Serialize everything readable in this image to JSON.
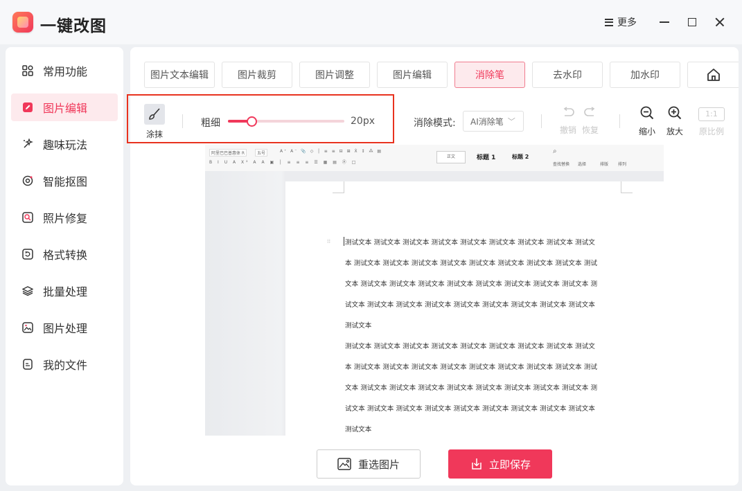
{
  "app": {
    "title": "一键改图",
    "more_label": "更多"
  },
  "colors": {
    "accent": "#f0385a",
    "accent_bg": "#fdeaed",
    "highlight_border": "#e8321e"
  },
  "sidebar": {
    "items": [
      {
        "label": "常用功能",
        "icon": "grid-icon"
      },
      {
        "label": "图片编辑",
        "icon": "edit-icon",
        "active": true
      },
      {
        "label": "趣味玩法",
        "icon": "sparkle-icon"
      },
      {
        "label": "智能抠图",
        "icon": "target-icon"
      },
      {
        "label": "照片修复",
        "icon": "repair-icon"
      },
      {
        "label": "格式转换",
        "icon": "convert-icon"
      },
      {
        "label": "批量处理",
        "icon": "layers-icon"
      },
      {
        "label": "图片处理",
        "icon": "image-icon"
      },
      {
        "label": "我的文件",
        "icon": "file-icon"
      }
    ]
  },
  "tabs": [
    {
      "label": "图片文本编辑"
    },
    {
      "label": "图片裁剪"
    },
    {
      "label": "图片调整"
    },
    {
      "label": "图片编辑"
    },
    {
      "label": "消除笔",
      "active": true
    },
    {
      "label": "去水印"
    },
    {
      "label": "加水印"
    }
  ],
  "toolbar": {
    "smear_label": "涂抹",
    "size_label": "粗细",
    "size_value": "20px",
    "size_fraction": 0.2,
    "mode_label": "消除模式:",
    "mode_value": "AI消除笔",
    "undo_label": "撤销",
    "redo_label": "恢复",
    "zoom_out_label": "缩小",
    "zoom_in_label": "放大",
    "ratio_button": "1:1",
    "original_label": "原比例"
  },
  "document": {
    "ribbon": {
      "font_name": "阿里巴巴普惠体 R",
      "font_size": "五号",
      "style_normal": "正文",
      "style_h1": "标题 1",
      "style_h2": "标题 2",
      "find_replace": "查找替换",
      "select": "选择",
      "sort": "排版",
      "arrange": "排列"
    },
    "paragraph1": [
      "测试文本 测试文本 测试文本 测试文本 测试文本 测试文本 测试文本 测试文本 测试文",
      "本 测试文本 测试文本 测试文本 测试文本 测试文本 测试文本 测试文本 测试文本 测试",
      "文本 测试文本 测试文本 测试文本 测试文本 测试文本 测试文本 测试文本 测试文本 测",
      "试文本 测试文本 测试文本 测试文本 测试文本 测试文本 测试文本 测试文本 测试文本",
      "测试文本"
    ],
    "paragraph2": [
      "测试文本 测试文本 测试文本 测试文本 测试文本 测试文本 测试文本 测试文本 测试文",
      "本 测试文本 测试文本 测试文本 测试文本 测试文本 测试文本 测试文本 测试文本 测试",
      "文本 测试文本 测试文本 测试文本 测试文本 测试文本 测试文本 测试文本 测试文本 测",
      "试文本 测试文本 测试文本 测试文本 测试文本 测试文本 测试文本 测试文本 测试文本",
      "测试文本"
    ]
  },
  "actions": {
    "reselect_label": "重选图片",
    "save_label": "立即保存"
  }
}
